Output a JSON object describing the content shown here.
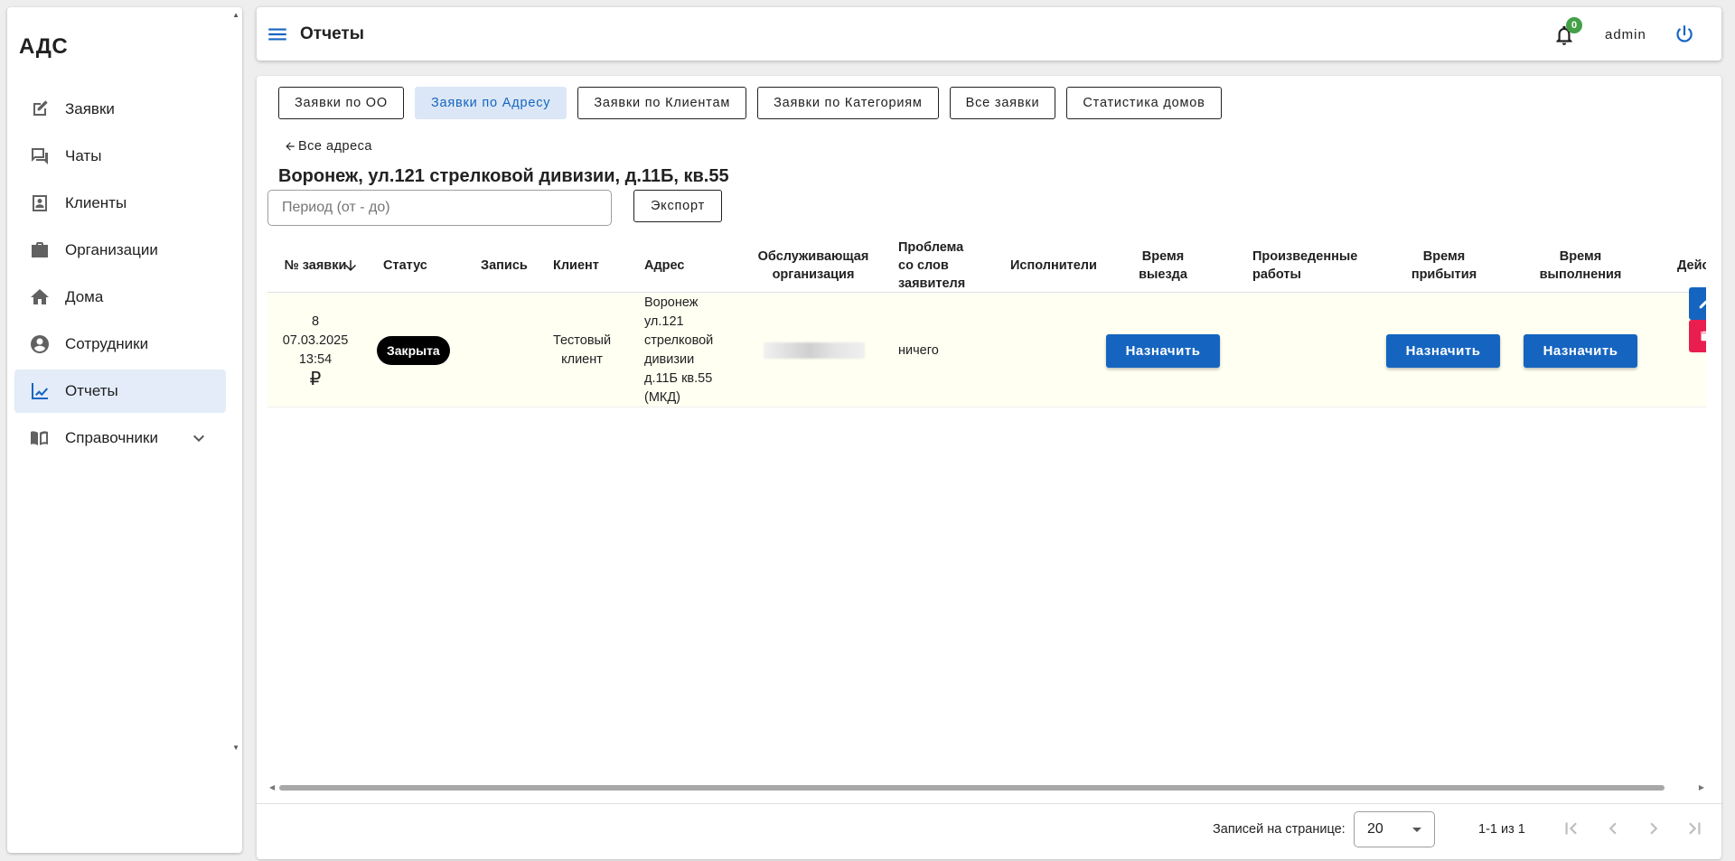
{
  "sidebar": {
    "brand": "АДС",
    "items": [
      {
        "label": "Заявки"
      },
      {
        "label": "Чаты"
      },
      {
        "label": "Клиенты"
      },
      {
        "label": "Организации"
      },
      {
        "label": "Дома"
      },
      {
        "label": "Сотрудники"
      },
      {
        "label": "Отчеты"
      },
      {
        "label": "Справочники"
      }
    ]
  },
  "header": {
    "title": "Отчеты",
    "notifications_count": "0",
    "user": "admin"
  },
  "tabs": [
    {
      "label": "Заявки по ОО"
    },
    {
      "label": "Заявки по Адресу"
    },
    {
      "label": "Заявки по Клиентам"
    },
    {
      "label": "Заявки по Категориям"
    },
    {
      "label": "Все заявки"
    },
    {
      "label": "Статистика домов"
    }
  ],
  "active_tab": "Заявки по Адресу",
  "back_link": "Все адреса",
  "page_heading": "Воронеж, ул.121 стрелковой дивизии, д.11Б, кв.55",
  "filters": {
    "period_placeholder": "Период (от - до)",
    "export_label": "Экспорт"
  },
  "table": {
    "columns": [
      "№ заявки",
      "Статус",
      "Запись",
      "Клиент",
      "Адрес",
      "Обслуживающая организация",
      "Проблема со слов заявителя",
      "Исполнители",
      "Время выезда",
      "Произведенные работы",
      "Время прибытия",
      "Время выполнения",
      "Действ"
    ],
    "rows": [
      {
        "number": "8",
        "date": "07.03.2025",
        "time": "13:54",
        "currency": "₽",
        "status": "Закрыта",
        "record": "",
        "client": "Тестовый клиент",
        "address": "Воронеж ул.121 стрелковой дивизии д.11Б кв.55 (МКД)",
        "organization": "",
        "problem": "ничего",
        "executors": "",
        "departure": "Назначить",
        "works": "",
        "arrival": "Назначить",
        "completion": "Назначить"
      }
    ]
  },
  "pagination": {
    "rows_per_page_label": "Записей на странице:",
    "rows_per_page": "20",
    "range": "1-1 из 1"
  },
  "colors": {
    "primary": "#1565c0",
    "active_nav_bg": "#e3ecf8",
    "badge": "#43a047",
    "delete": "#e91e4f",
    "row_bg": "#fffff2"
  }
}
